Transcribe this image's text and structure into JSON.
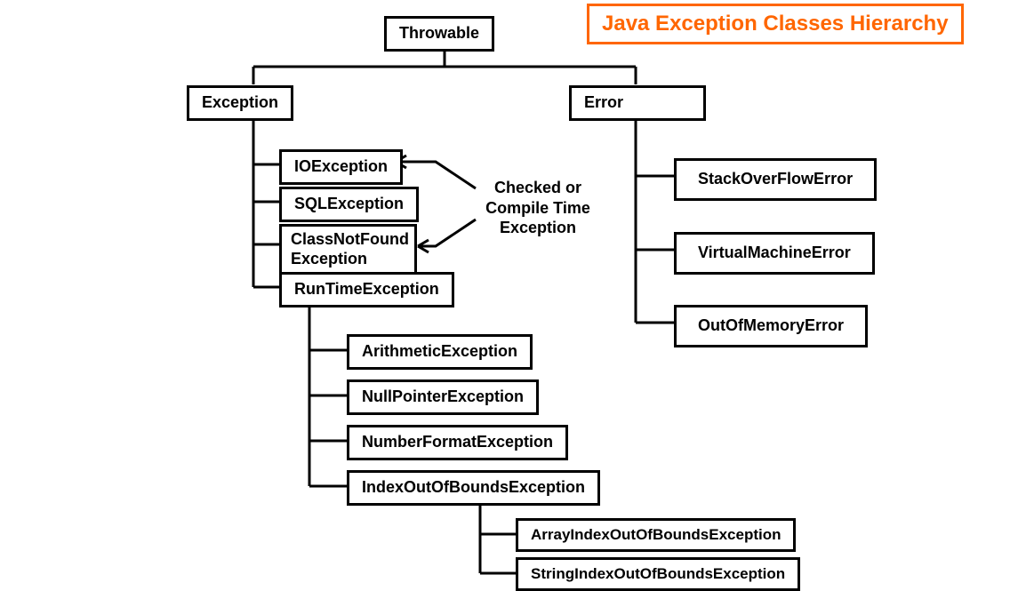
{
  "title": "Java Exception Classes Hierarchy",
  "root": "Throwable",
  "exception": {
    "label": "Exception",
    "children": {
      "io": "IOException",
      "sql": "SQLException",
      "cnf_line1": "ClassNotFound",
      "cnf_line2": "Exception",
      "runtime": "RunTimeException"
    },
    "runtime_children": {
      "arith": "ArithmeticException",
      "npe": "NullPointerException",
      "nfe": "NumberFormatException",
      "ioobe": "IndexOutOfBoundsException"
    },
    "ioobe_children": {
      "aioobe": "ArrayIndexOutOfBoundsException",
      "sioobe": "StringIndexOutOfBoundsException"
    }
  },
  "error": {
    "label": "Error",
    "children": {
      "sof": "StackOverFlowError",
      "vme": "VirtualMachineError",
      "oom": "OutOfMemoryError"
    }
  },
  "annotation": "Checked or\nCompile Time\nException"
}
